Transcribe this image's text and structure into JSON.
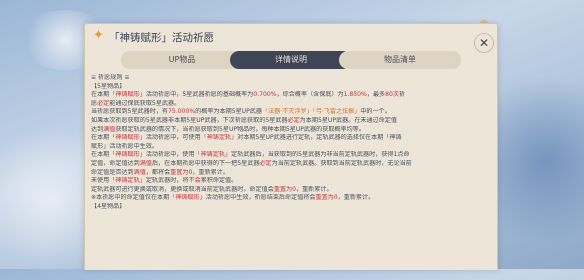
{
  "window": {
    "title": "「神铸赋形」活动祈愿",
    "close_label": "✕"
  },
  "tabs": [
    {
      "label": "UP物品",
      "active": false
    },
    {
      "label": "详情说明",
      "active": true
    },
    {
      "label": "物品清单",
      "active": false
    }
  ],
  "content": {
    "lines": [
      "≡ 祈愿规则 ≡",
      "【5星物品】",
      "在本期「神铸赋形」活动祈愿中，5星武器祈愿的基础概率为0.700%，综合概率（含保底）为1.850%，最多80次祈",
      "愿必定能通过保底获取5星武器。",
      "当祈愿获取到5星武器时，有75.000%的概率为本期5星UP武器「法器·不灭浮罗」「弓·飞雷之弦振」中的一个。",
      "如果本次祈愿获取的5星武器非本期5星UP武器，下次祈愿获取的5星武器必定为本期5星UP武器。在未通过命定值",
      "达到满值获取定轨武器的情况下，当祈愿获取到5星UP物品时，每种本期5星UP武器的获取概率均等。",
      "在本期「神铸赋形」活动祈愿中，可使用「神铸定轨」对本期5星UP武器进行定轨，定轨武器的选择仅在本期「神铸",
      "赋形」活动祈愿中生效。",
      "在本期「神铸赋形」活动祈愿中，使用「神铸定轨」定轨武器后，当获取到的5星武器为非当前定轨武器时，获得1点命",
      "定值，命定值达到满值后，在本期祈愿中获得的下一把5星武器必定为当前定轨武器。获取到当前定轨武器时，无论当前",
      "命定值是否达到满值，都将会重置为0，重新累计。",
      "未使用「神铸定轨」定轨武器时，将不会累积命定值。",
      "定轨武器可进行更换或取消，更换或取消当前定轨武器时，命定值会重置为0，重新累计。",
      "※本祈愿中的命定值仅在本期「神铸赋形」活动祈愿中生效，祈愿结束后命定值将会重置为0，重新累计。",
      "【4星物品】"
    ]
  },
  "colors": {
    "highlight_red": "#c4323a",
    "highlight_orange": "#d7701f",
    "panel_bg": "#ece5d8",
    "tab_active_bg": "#3e4556"
  },
  "icons": {
    "title_icon": "sparkle-icon",
    "close_icon": "close-icon"
  }
}
